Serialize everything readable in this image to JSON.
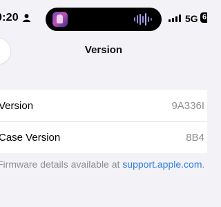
{
  "status_bar": {
    "time": "0:20",
    "network": "5G",
    "battery": "6"
  },
  "nav": {
    "title": "Version"
  },
  "rows": [
    {
      "label": "Version",
      "value": "9A336I"
    },
    {
      "label": "Case Version",
      "value": "8B4"
    }
  ],
  "footer": {
    "text": "Firmware details available at ",
    "link": "support.apple.com",
    "suffix": "."
  },
  "icons": [
    "person-icon",
    "album-art-icon",
    "waveform-icon",
    "signal-icon",
    "battery-icon",
    "back-button"
  ],
  "colors": {
    "background": "#f2f2f7",
    "card": "#ffffff",
    "secondary_text": "#8e8e93",
    "link": "#2f7de1"
  }
}
